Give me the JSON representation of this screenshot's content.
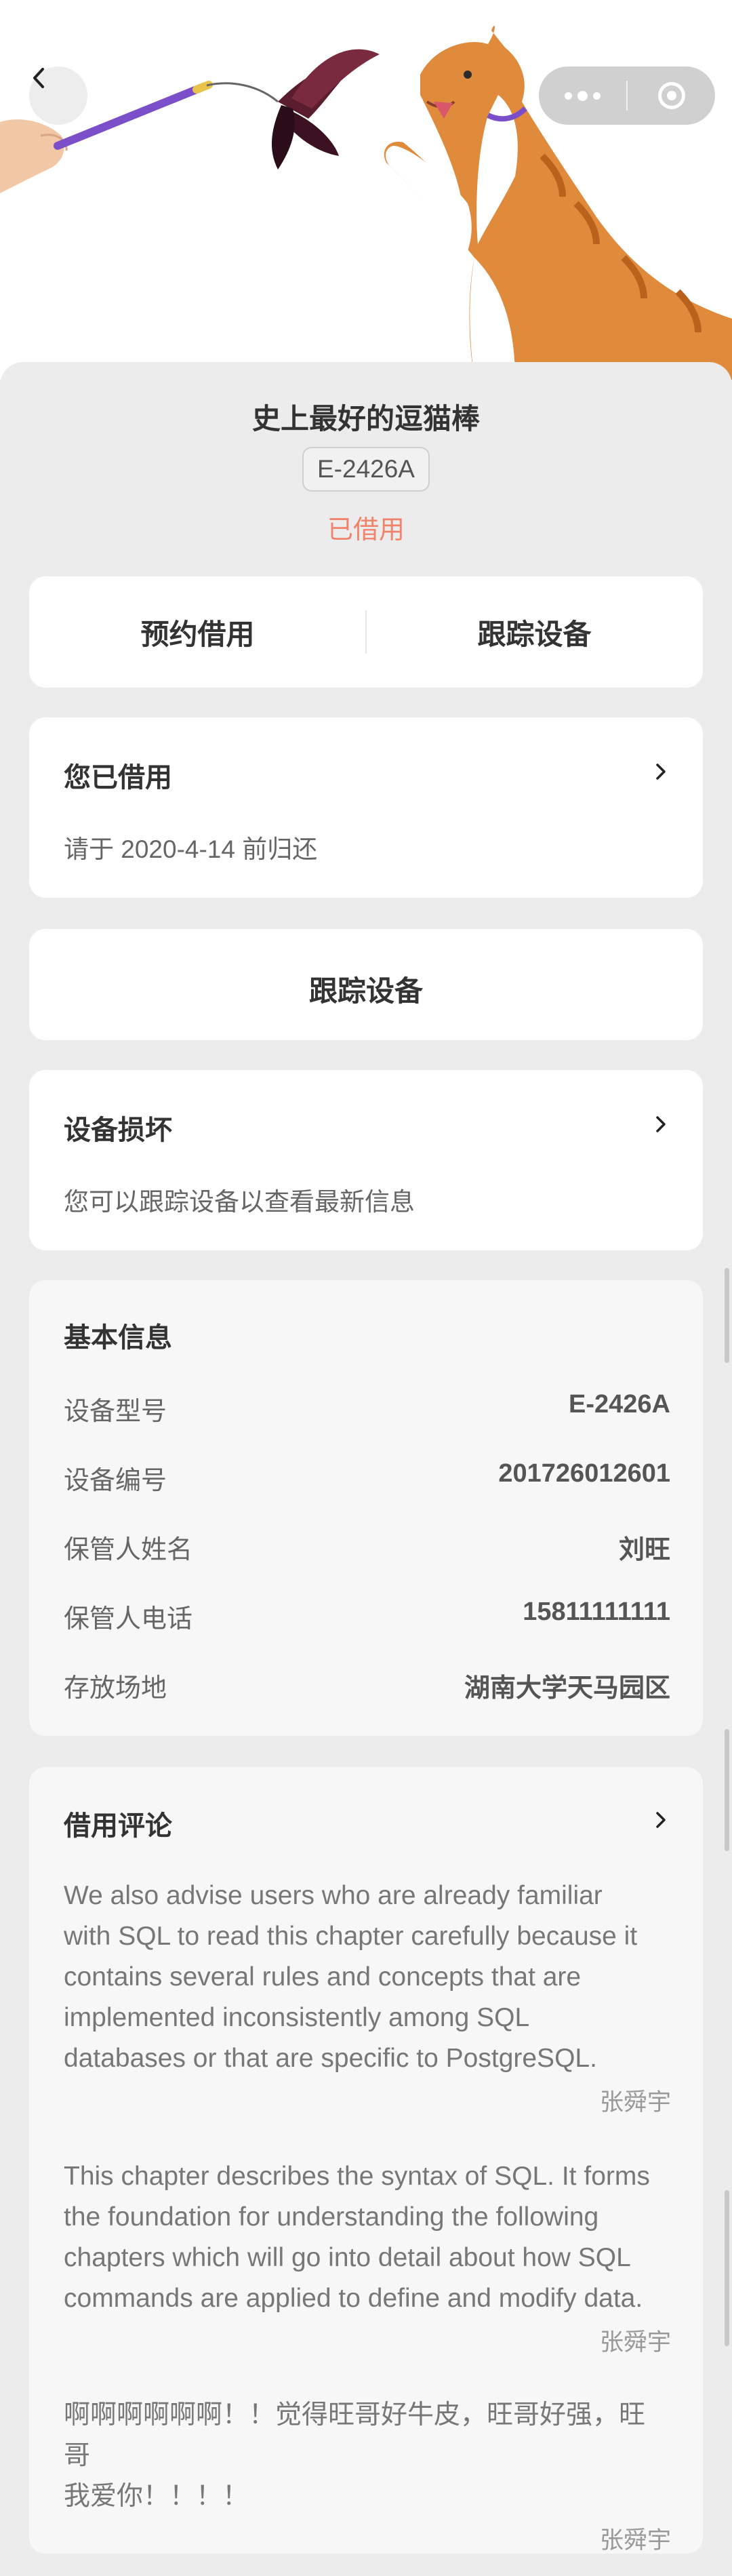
{
  "hero": {
    "image_alt": "逗猫棒与猫",
    "back_icon": "chevron-left-icon",
    "more_icon": "more-dots-icon",
    "close_icon": "target-circle-icon"
  },
  "device": {
    "name": "史上最好的逗猫棒",
    "model_code": "E-2426A",
    "status": "已借用",
    "status_color": "#f2836b"
  },
  "actions": {
    "reserve_label": "预约借用",
    "track_label": "跟踪设备"
  },
  "borrowed": {
    "title": "您已借用",
    "subtitle": "请于 2020-4-14 前归还"
  },
  "track_button": {
    "label": "跟踪设备"
  },
  "damage": {
    "title": "设备损坏",
    "subtitle": "您可以跟踪设备以查看最新信息"
  },
  "basic_info": {
    "title": "基本信息",
    "rows": [
      {
        "key": "设备型号",
        "value": "E-2426A"
      },
      {
        "key": "设备编号",
        "value": "201726012601"
      },
      {
        "key": "保管人姓名",
        "value": "刘旺"
      },
      {
        "key": "保管人电话",
        "value": "15811111111"
      },
      {
        "key": "存放场地",
        "value": "湖南大学天马园区"
      }
    ]
  },
  "comments": {
    "title": "借用评论",
    "items": [
      {
        "lines": [
          "We also advise users who are already familiar",
          "with SQL to read this chapter carefully because it",
          "contains several rules and concepts that are",
          "implemented inconsistently among SQL",
          "databases or that are specific to PostgreSQL."
        ],
        "author": "张舜宇"
      },
      {
        "lines": [
          "This chapter describes the syntax of SQL. It forms",
          "the foundation for understanding the following",
          "chapters which will go into detail about how SQL",
          "commands are applied to define and modify data."
        ],
        "author": "张舜宇"
      },
      {
        "lines": [
          "啊啊啊啊啊啊！！觉得旺哥好牛皮，旺哥好强，旺哥",
          "我爱你！！！！"
        ],
        "author": "张舜宇"
      }
    ]
  }
}
